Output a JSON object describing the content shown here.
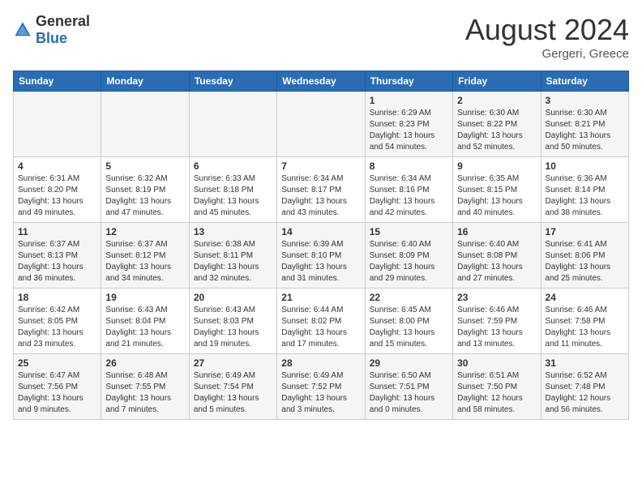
{
  "header": {
    "logo_general": "General",
    "logo_blue": "Blue",
    "month_year": "August 2024",
    "location": "Gergeri, Greece"
  },
  "days_of_week": [
    "Sunday",
    "Monday",
    "Tuesday",
    "Wednesday",
    "Thursday",
    "Friday",
    "Saturday"
  ],
  "weeks": [
    [
      {
        "day": "",
        "detail": ""
      },
      {
        "day": "",
        "detail": ""
      },
      {
        "day": "",
        "detail": ""
      },
      {
        "day": "",
        "detail": ""
      },
      {
        "day": "1",
        "detail": "Sunrise: 6:29 AM\nSunset: 8:23 PM\nDaylight: 13 hours\nand 54 minutes."
      },
      {
        "day": "2",
        "detail": "Sunrise: 6:30 AM\nSunset: 8:22 PM\nDaylight: 13 hours\nand 52 minutes."
      },
      {
        "day": "3",
        "detail": "Sunrise: 6:30 AM\nSunset: 8:21 PM\nDaylight: 13 hours\nand 50 minutes."
      }
    ],
    [
      {
        "day": "4",
        "detail": "Sunrise: 6:31 AM\nSunset: 8:20 PM\nDaylight: 13 hours\nand 49 minutes."
      },
      {
        "day": "5",
        "detail": "Sunrise: 6:32 AM\nSunset: 8:19 PM\nDaylight: 13 hours\nand 47 minutes."
      },
      {
        "day": "6",
        "detail": "Sunrise: 6:33 AM\nSunset: 8:18 PM\nDaylight: 13 hours\nand 45 minutes."
      },
      {
        "day": "7",
        "detail": "Sunrise: 6:34 AM\nSunset: 8:17 PM\nDaylight: 13 hours\nand 43 minutes."
      },
      {
        "day": "8",
        "detail": "Sunrise: 6:34 AM\nSunset: 8:16 PM\nDaylight: 13 hours\nand 42 minutes."
      },
      {
        "day": "9",
        "detail": "Sunrise: 6:35 AM\nSunset: 8:15 PM\nDaylight: 13 hours\nand 40 minutes."
      },
      {
        "day": "10",
        "detail": "Sunrise: 6:36 AM\nSunset: 8:14 PM\nDaylight: 13 hours\nand 38 minutes."
      }
    ],
    [
      {
        "day": "11",
        "detail": "Sunrise: 6:37 AM\nSunset: 8:13 PM\nDaylight: 13 hours\nand 36 minutes."
      },
      {
        "day": "12",
        "detail": "Sunrise: 6:37 AM\nSunset: 8:12 PM\nDaylight: 13 hours\nand 34 minutes."
      },
      {
        "day": "13",
        "detail": "Sunrise: 6:38 AM\nSunset: 8:11 PM\nDaylight: 13 hours\nand 32 minutes."
      },
      {
        "day": "14",
        "detail": "Sunrise: 6:39 AM\nSunset: 8:10 PM\nDaylight: 13 hours\nand 31 minutes."
      },
      {
        "day": "15",
        "detail": "Sunrise: 6:40 AM\nSunset: 8:09 PM\nDaylight: 13 hours\nand 29 minutes."
      },
      {
        "day": "16",
        "detail": "Sunrise: 6:40 AM\nSunset: 8:08 PM\nDaylight: 13 hours\nand 27 minutes."
      },
      {
        "day": "17",
        "detail": "Sunrise: 6:41 AM\nSunset: 8:06 PM\nDaylight: 13 hours\nand 25 minutes."
      }
    ],
    [
      {
        "day": "18",
        "detail": "Sunrise: 6:42 AM\nSunset: 8:05 PM\nDaylight: 13 hours\nand 23 minutes."
      },
      {
        "day": "19",
        "detail": "Sunrise: 6:43 AM\nSunset: 8:04 PM\nDaylight: 13 hours\nand 21 minutes."
      },
      {
        "day": "20",
        "detail": "Sunrise: 6:43 AM\nSunset: 8:03 PM\nDaylight: 13 hours\nand 19 minutes."
      },
      {
        "day": "21",
        "detail": "Sunrise: 6:44 AM\nSunset: 8:02 PM\nDaylight: 13 hours\nand 17 minutes."
      },
      {
        "day": "22",
        "detail": "Sunrise: 6:45 AM\nSunset: 8:00 PM\nDaylight: 13 hours\nand 15 minutes."
      },
      {
        "day": "23",
        "detail": "Sunrise: 6:46 AM\nSunset: 7:59 PM\nDaylight: 13 hours\nand 13 minutes."
      },
      {
        "day": "24",
        "detail": "Sunrise: 6:46 AM\nSunset: 7:58 PM\nDaylight: 13 hours\nand 11 minutes."
      }
    ],
    [
      {
        "day": "25",
        "detail": "Sunrise: 6:47 AM\nSunset: 7:56 PM\nDaylight: 13 hours\nand 9 minutes."
      },
      {
        "day": "26",
        "detail": "Sunrise: 6:48 AM\nSunset: 7:55 PM\nDaylight: 13 hours\nand 7 minutes."
      },
      {
        "day": "27",
        "detail": "Sunrise: 6:49 AM\nSunset: 7:54 PM\nDaylight: 13 hours\nand 5 minutes."
      },
      {
        "day": "28",
        "detail": "Sunrise: 6:49 AM\nSunset: 7:52 PM\nDaylight: 13 hours\nand 3 minutes."
      },
      {
        "day": "29",
        "detail": "Sunrise: 6:50 AM\nSunset: 7:51 PM\nDaylight: 13 hours\nand 0 minutes."
      },
      {
        "day": "30",
        "detail": "Sunrise: 6:51 AM\nSunset: 7:50 PM\nDaylight: 12 hours\nand 58 minutes."
      },
      {
        "day": "31",
        "detail": "Sunrise: 6:52 AM\nSunset: 7:48 PM\nDaylight: 12 hours\nand 56 minutes."
      }
    ]
  ]
}
